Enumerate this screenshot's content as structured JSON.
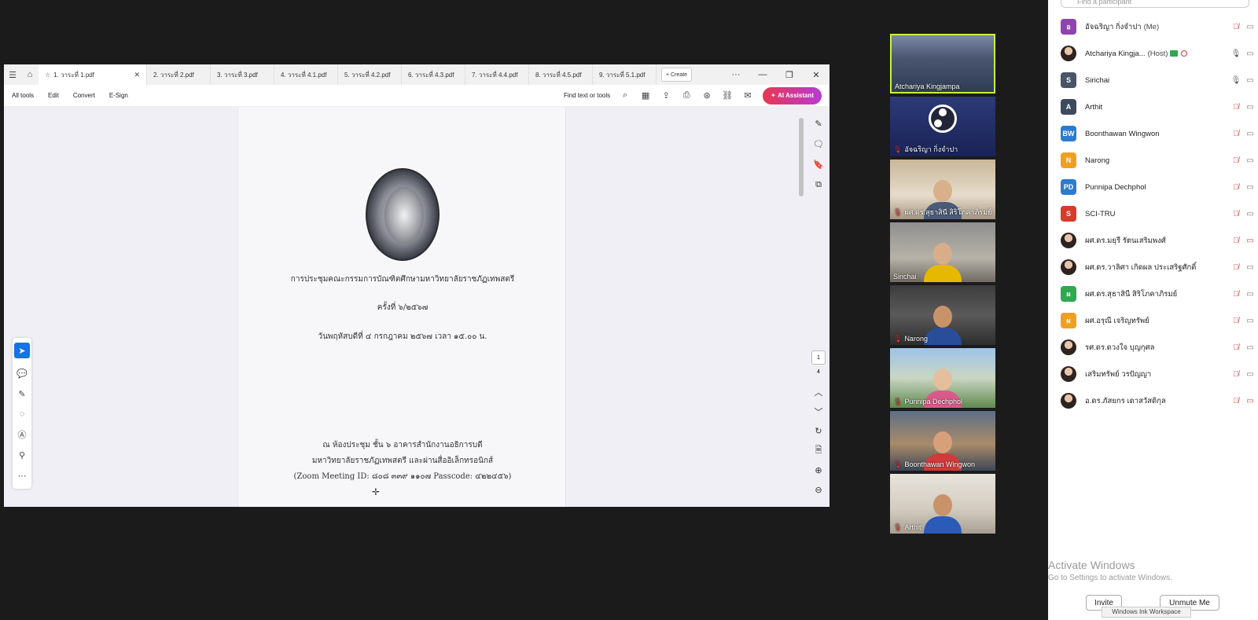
{
  "pdf": {
    "tabs": [
      {
        "label": "1. วาระที่ 1.pdf"
      },
      {
        "label": "2. วาระที่ 2.pdf"
      },
      {
        "label": "3. วาระที่ 3.pdf"
      },
      {
        "label": "4. วาระที่ 4.1.pdf"
      },
      {
        "label": "5. วาระที่ 4.2.pdf"
      },
      {
        "label": "6. วาระที่ 4.3.pdf"
      },
      {
        "label": "7. วาระที่ 4.4.pdf"
      },
      {
        "label": "8. วาระที่ 4.5.pdf"
      },
      {
        "label": "9. วาระที่ 5.1.pdf"
      }
    ],
    "create_label": "Create",
    "more_label": "···",
    "menus": [
      "All tools",
      "Edit",
      "Convert",
      "E-Sign"
    ],
    "find_label": "Find text or tools",
    "ai_label": "AI Assistant",
    "document": {
      "line1": "การประชุมคณะกรรมการบัณฑิตศึกษามหาวิทยาลัยราชภัฏเทพสตรี",
      "line2": "ครั้งที่ ๖/๒๕๖๗",
      "line3": "วันพฤหัสบดีที่ ๔ กรกฎาคม ๒๕๖๗ เวลา ๑๕.๐๐ น.",
      "line4": "ณ ห้องประชุม ชั้น ๖ อาคารสำนักงานอธิการบดี",
      "line5": "มหาวิทยาลัยราชภัฏเทพสตรี และผ่านสื่ออิเล็กทรอนิกส์",
      "line6": "(Zoom Meeting ID: ๘๐๘ ๓๓๙ ๑๑๐๗ Passcode: ๔๒๒๔๕๖)"
    },
    "page_current": "1",
    "page_total": "4"
  },
  "videos": [
    {
      "name": "Atchariya Kingjampa",
      "muted": false
    },
    {
      "name": "อัจฉริญา กิ่งจำปา",
      "muted": true
    },
    {
      "name": "ผศ.ดร.สุธาสินี สิริโภคาภิรมย์",
      "muted": true
    },
    {
      "name": "Sirichai",
      "muted": false
    },
    {
      "name": "Narong",
      "muted": true
    },
    {
      "name": "Punnipa Dechphol",
      "muted": true
    },
    {
      "name": "Boonthawan Wingwon",
      "muted": true
    },
    {
      "name": "Arthit",
      "muted": true
    }
  ],
  "participants": {
    "search_placeholder": "Find a participant",
    "list": [
      {
        "initials": "อ",
        "color": "#8e44ad",
        "name": "อัจฉริญา กิ่งจำปา",
        "role": "(Me)",
        "mic_on": false,
        "cam_off": false
      },
      {
        "initials": "",
        "color": "#555555",
        "name": "Atchariya Kingja...",
        "role": "(Host)",
        "mic_on": true,
        "cam_off": false,
        "photo": true,
        "host": true
      },
      {
        "initials": "S",
        "color": "#4a5568",
        "name": "Sirichai",
        "role": "",
        "mic_on": true,
        "cam_off": false
      },
      {
        "initials": "A",
        "color": "#3d4a5c",
        "name": "Arthit",
        "role": "",
        "mic_on": false,
        "cam_off": false
      },
      {
        "initials": "BW",
        "color": "#2b7bd0",
        "name": "Boonthawan Wingwon",
        "role": "",
        "mic_on": false,
        "cam_off": false
      },
      {
        "initials": "N",
        "color": "#f0a020",
        "name": "Narong",
        "role": "",
        "mic_on": false,
        "cam_off": false
      },
      {
        "initials": "PD",
        "color": "#2b7bd0",
        "name": "Punnipa Dechphol",
        "role": "",
        "mic_on": false,
        "cam_off": false
      },
      {
        "initials": "S",
        "color": "#d63b2c",
        "name": "SCI-TRU",
        "role": "",
        "mic_on": false,
        "cam_off": false
      },
      {
        "initials": "",
        "color": "#555555",
        "name": "ผศ.ดร.มยุรี รัตนเสริมพงศ์",
        "role": "",
        "mic_on": false,
        "cam_off": true,
        "photo": true
      },
      {
        "initials": "",
        "color": "#555555",
        "name": "ผศ.ดร.วาลิศา เกิดผล ประเสริฐศักดิ์",
        "role": "",
        "mic_on": false,
        "cam_off": false,
        "photo": true
      },
      {
        "initials": "ผ",
        "color": "#2fa84f",
        "name": "ผศ.ดร.สุธาสินี สิริโภคาภิรมย์",
        "role": "",
        "mic_on": false,
        "cam_off": false
      },
      {
        "initials": "ผ",
        "color": "#f0a020",
        "name": "ผศ.อรุณี เจริญทรัพย์",
        "role": "",
        "mic_on": false,
        "cam_off": false
      },
      {
        "initials": "",
        "color": "#555555",
        "name": "รศ.ดร.ดวงใจ บุญกุศล",
        "role": "",
        "mic_on": false,
        "cam_off": false,
        "photo": true
      },
      {
        "initials": "",
        "color": "#555555",
        "name": "เสริมทรัพย์ วรปัญญา",
        "role": "",
        "mic_on": false,
        "cam_off": false,
        "photo": true
      },
      {
        "initials": "",
        "color": "#555555",
        "name": "อ.ดร.ภัสยกร เดาสวัสดิกุล",
        "role": "",
        "mic_on": false,
        "cam_off": true,
        "photo": true
      }
    ],
    "invite_label": "Invite",
    "unmute_label": "Unmute Me"
  },
  "activate_windows": {
    "title": "Activate Windows",
    "subtitle": "Go to Settings to activate Windows."
  },
  "ink_workspace": "Windows Ink Workspace"
}
